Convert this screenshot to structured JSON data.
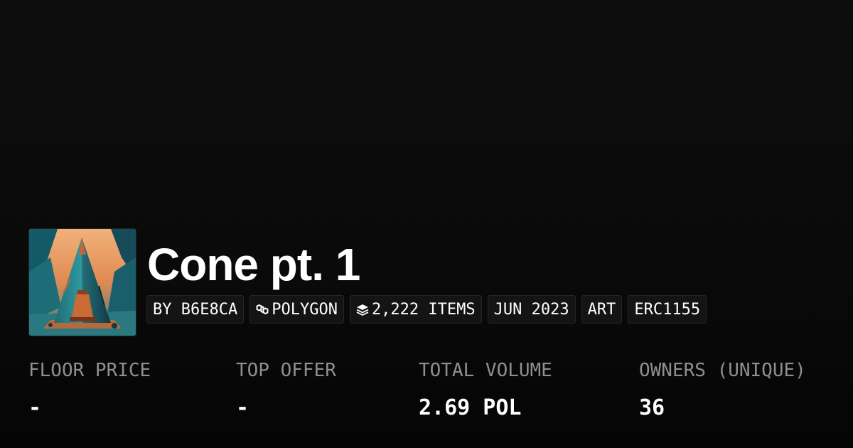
{
  "collection": {
    "title": "Cone pt. 1",
    "thumbnail_icon": "cone-artwork-image"
  },
  "tags": {
    "creator": "BY B6E8CA",
    "chain": "POLYGON",
    "chain_icon": "polygon-link-icon",
    "items": "2,222 ITEMS",
    "items_icon": "layers-icon",
    "date": "JUN 2023",
    "category": "ART",
    "standard": "ERC1155"
  },
  "stats": {
    "floor_price": {
      "label": "FLOOR PRICE",
      "value": "-"
    },
    "top_offer": {
      "label": "TOP OFFER",
      "value": "-"
    },
    "total_volume": {
      "label": "TOTAL VOLUME",
      "value": "2.69 POL"
    },
    "owners": {
      "label": "OWNERS (UNIQUE)",
      "value": "36"
    }
  },
  "colors": {
    "background": "#0a0a0a",
    "tag_background": "#141414",
    "label_gray": "#8f8f8f",
    "text": "#ffffff"
  }
}
